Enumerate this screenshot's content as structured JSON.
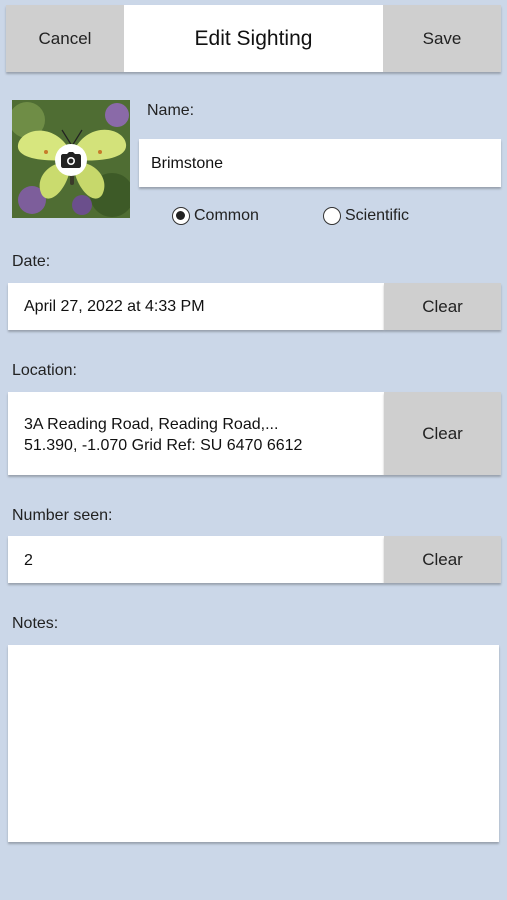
{
  "header": {
    "cancel_label": "Cancel",
    "title": "Edit Sighting",
    "save_label": "Save"
  },
  "name": {
    "label": "Name:",
    "value": "Brimstone",
    "options": [
      {
        "label": "Common",
        "selected": true
      },
      {
        "label": "Scientific",
        "selected": false
      }
    ]
  },
  "photo": {
    "icon": "camera-icon"
  },
  "date": {
    "label": "Date:",
    "value": "April 27, 2022 at 4:33 PM",
    "clear_label": "Clear"
  },
  "location": {
    "label": "Location:",
    "line1": "3A Reading Road, Reading Road,...",
    "line2": "51.390, -1.070  Grid Ref: SU 6470 6612",
    "clear_label": "Clear"
  },
  "number_seen": {
    "label": "Number seen:",
    "value": "2",
    "clear_label": "Clear"
  },
  "notes": {
    "label": "Notes:",
    "value": ""
  }
}
